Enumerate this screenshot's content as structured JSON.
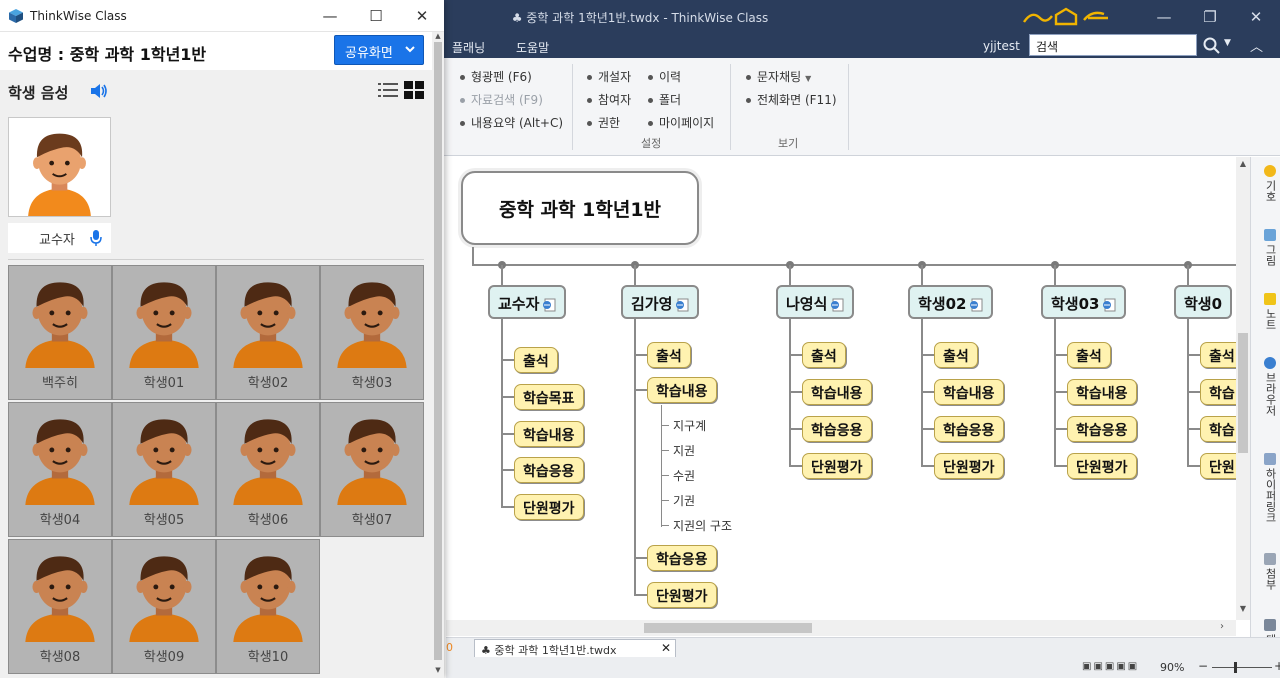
{
  "main_window": {
    "title": "♣ 중학 과학 1학년1반.twdx - ThinkWise Class",
    "menu": [
      "플래닝",
      "도움말"
    ],
    "user": "yjjtest",
    "search": {
      "value": "검색"
    },
    "ribbon": {
      "col1": [
        "형광펜 (F6)",
        "자료검색 (F9)",
        "내용요약 (Alt+C)"
      ],
      "col2": [
        "개설자",
        "참여자",
        "권한"
      ],
      "col3": [
        "이력",
        "폴더",
        "마이페이지"
      ],
      "col4": [
        "문자채팅",
        "전체화면 (F11)"
      ],
      "group_labels": [
        "설정",
        "보기"
      ]
    },
    "mindmap": {
      "root": "중학 과학 1학년1반",
      "topics": [
        {
          "label": "교수자",
          "subs": [
            "출석",
            "학습목표",
            "학습내용",
            "학습응용",
            "단원평가"
          ]
        },
        {
          "label": "김가영",
          "subs": [
            "출석",
            "학습내용",
            "학습응용",
            "단원평가"
          ],
          "details": [
            "지구계",
            "지권",
            "수권",
            "기권",
            "지권의 구조"
          ]
        },
        {
          "label": "나영식",
          "subs": [
            "출석",
            "학습내용",
            "학습응용",
            "단원평가"
          ]
        },
        {
          "label": "학생02",
          "subs": [
            "출석",
            "학습내용",
            "학습응용",
            "단원평가"
          ]
        },
        {
          "label": "학생03",
          "subs": [
            "출석",
            "학습내용",
            "학습응용",
            "단원평가"
          ]
        },
        {
          "label": "학생0",
          "subs": [
            "출석",
            "학습",
            "학습",
            "단원"
          ]
        }
      ]
    },
    "side_tabs": [
      "기호",
      "그림",
      "노트",
      "브라우저",
      "하이퍼링크",
      "첨부",
      "태스"
    ],
    "document_tab": "중학 과학 1학년1반.twdx",
    "zoom": "90%",
    "colors": {
      "title_bar": "#2b3d5c",
      "topic_fill": "#dff2f1",
      "subtopic_fill": "#fff2b0",
      "accent_gold": "#f0b400"
    }
  },
  "class_window": {
    "title": "ThinkWise Class",
    "class_name": "수업명 : 중학 과학 1학년1반",
    "share_button": "공유화면",
    "voice_label": "학생 음성",
    "teacher_label": "교수자",
    "students": [
      "백주히",
      "학생01",
      "학생02",
      "학생03",
      "학생04",
      "학생05",
      "학생06",
      "학생07",
      "학생08",
      "학생09",
      "학생10"
    ],
    "colors": {
      "share_button": "#1a74e8",
      "tile_bg": "#b4b4b4"
    }
  }
}
